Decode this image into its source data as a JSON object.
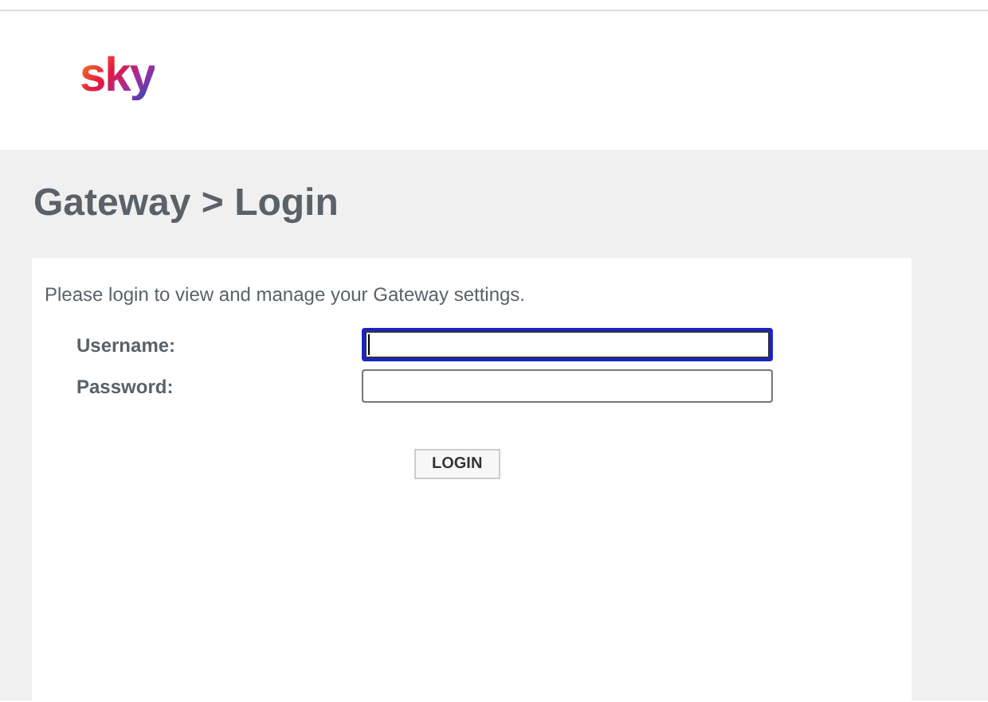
{
  "header": {
    "logo": "sky"
  },
  "title": "Gateway > Login",
  "panel": {
    "intro": "Please login to view and manage your Gateway settings.",
    "fields": [
      {
        "label": "Username:",
        "focused": true
      },
      {
        "label": "Password:",
        "focused": false
      }
    ],
    "button": "LOGIN"
  }
}
